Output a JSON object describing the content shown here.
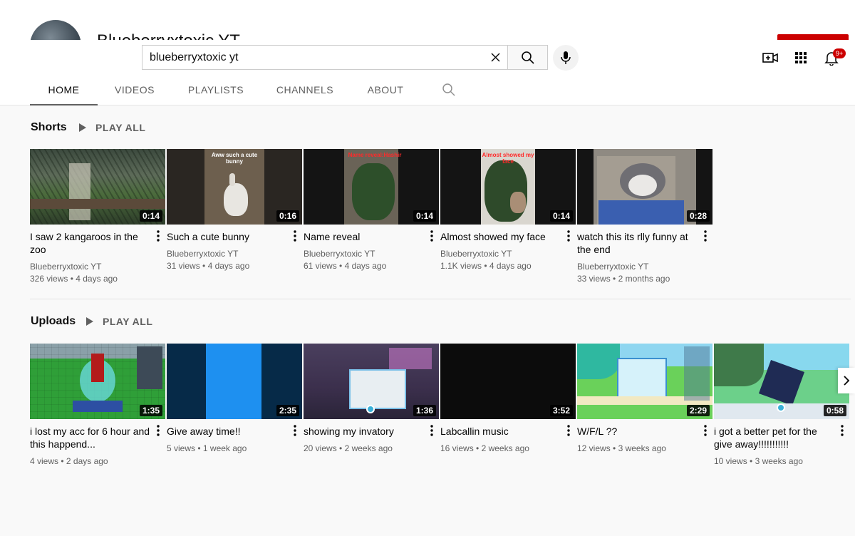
{
  "channel": {
    "name": "Blueberryxtoxic YT"
  },
  "search": {
    "value": "blueberryxtoxic yt",
    "placeholder": "Search"
  },
  "notifications": {
    "count": "9+"
  },
  "tabs": [
    {
      "label": "HOME",
      "active": true
    },
    {
      "label": "VIDEOS"
    },
    {
      "label": "PLAYLISTS"
    },
    {
      "label": "CHANNELS"
    },
    {
      "label": "ABOUT"
    }
  ],
  "shorts": {
    "title": "Shorts",
    "play_all": "PLAY ALL",
    "videos": [
      {
        "title": "I saw 2 kangaroos in the zoo",
        "channel": "Blueberryxtoxic YT",
        "views": "326 views",
        "age": "4 days ago",
        "duration": "0:14"
      },
      {
        "title": "Such a cute bunny",
        "channel": "Blueberryxtoxic YT",
        "views": "31 views",
        "age": "4 days ago",
        "duration": "0:16",
        "caption": "Aww such a cute bunny"
      },
      {
        "title": "Name reveal",
        "channel": "Blueberryxtoxic YT",
        "views": "61 views",
        "age": "4 days ago",
        "duration": "0:14",
        "caption": "Name reveal:Hashir"
      },
      {
        "title": "Almost showed my face",
        "channel": "Blueberryxtoxic YT",
        "views": "1.1K views",
        "age": "4 days ago",
        "duration": "0:14",
        "caption": "Almost showed my face"
      },
      {
        "title": "watch this its rlly funny at the end",
        "channel": "Blueberryxtoxic YT",
        "views": "33 views",
        "age": "2 months ago",
        "duration": "0:28"
      }
    ]
  },
  "uploads": {
    "title": "Uploads",
    "play_all": "PLAY ALL",
    "videos": [
      {
        "title": "i lost my acc for 6 hour and this happend...",
        "views": "4 views",
        "age": "2 days ago",
        "duration": "1:35"
      },
      {
        "title": "Give away time!!",
        "views": "5 views",
        "age": "1 week ago",
        "duration": "2:35"
      },
      {
        "title": "showing my invatory",
        "views": "20 views",
        "age": "2 weeks ago",
        "duration": "1:36"
      },
      {
        "title": "Labcallin music",
        "views": "16 views",
        "age": "2 weeks ago",
        "duration": "3:52"
      },
      {
        "title": "W/F/L ??",
        "views": "12 views",
        "age": "3 weeks ago",
        "duration": "2:29"
      },
      {
        "title": "i got a better pet for the give away!!!!!!!!!!!",
        "views": "10 views",
        "age": "3 weeks ago",
        "duration": "0:58"
      }
    ]
  }
}
